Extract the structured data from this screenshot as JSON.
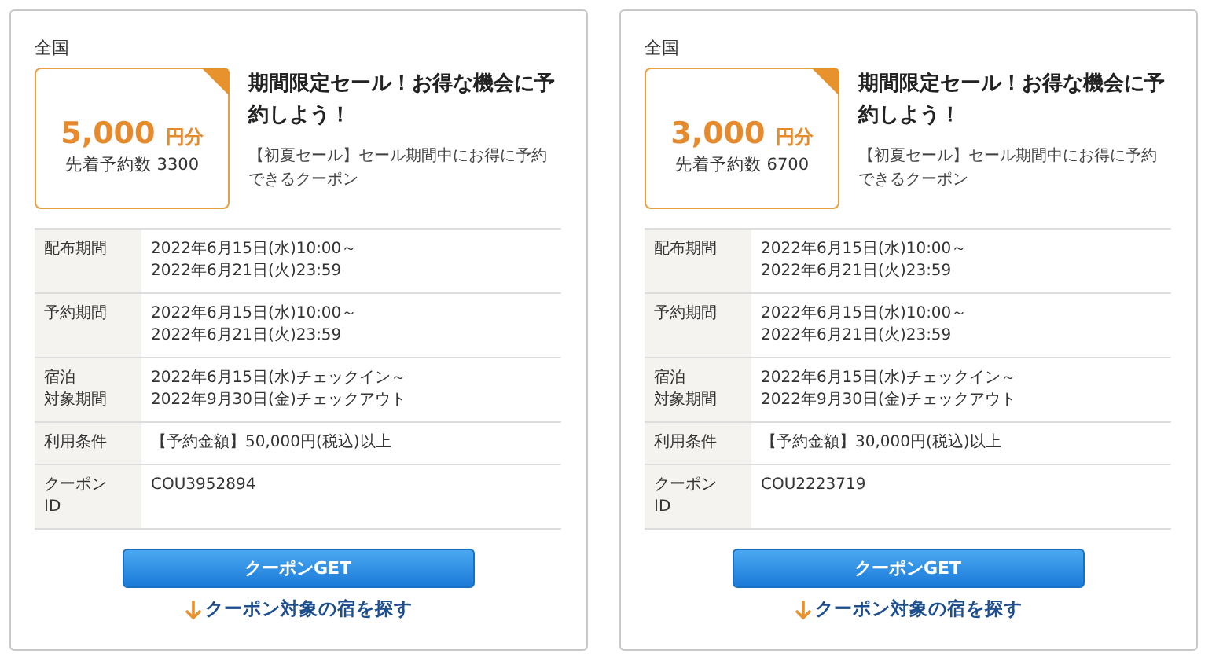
{
  "coupons": [
    {
      "region": "全国",
      "amount": "5,000",
      "unit": "円分",
      "remaining": "先着予約数 3300",
      "title": "期間限定セール！お得な機会に予約しよう！",
      "description": "【初夏セール】セール期間中にお得に予約できるクーポン",
      "details": [
        {
          "label": "配布期間",
          "lines": [
            "2022年6月15日(水)10:00～",
            "2022年6月21日(火)23:59"
          ]
        },
        {
          "label": "予約期間",
          "lines": [
            "2022年6月15日(水)10:00～",
            "2022年6月21日(火)23:59"
          ]
        },
        {
          "label": "宿泊",
          "label_2": "対象期間",
          "lines": [
            "2022年6月15日(水)チェックイン～",
            "2022年9月30日(金)チェックアウト"
          ]
        },
        {
          "label": "利用条件",
          "lines": [
            "【予約金額】50,000円(税込)以上"
          ]
        },
        {
          "label": "クーポン",
          "label_2": "ID",
          "lines": [
            "COU3952894"
          ]
        }
      ],
      "button": "クーポンGET",
      "link": "クーポン対象の宿を探す"
    },
    {
      "region": "全国",
      "amount": "3,000",
      "unit": "円分",
      "remaining": "先着予約数 6700",
      "title": "期間限定セール！お得な機会に予約しよう！",
      "description": "【初夏セール】セール期間中にお得に予約できるクーポン",
      "details": [
        {
          "label": "配布期間",
          "lines": [
            "2022年6月15日(水)10:00～",
            "2022年6月21日(火)23:59"
          ]
        },
        {
          "label": "予約期間",
          "lines": [
            "2022年6月15日(水)10:00～",
            "2022年6月21日(火)23:59"
          ]
        },
        {
          "label": "宿泊",
          "label_2": "対象期間",
          "lines": [
            "2022年6月15日(水)チェックイン～",
            "2022年9月30日(金)チェックアウト"
          ]
        },
        {
          "label": "利用条件",
          "lines": [
            "【予約金額】30,000円(税込)以上"
          ]
        },
        {
          "label": "クーポン",
          "label_2": "ID",
          "lines": [
            "COU2223719"
          ]
        }
      ],
      "button": "クーポンGET",
      "link": "クーポン対象の宿を探す"
    }
  ]
}
